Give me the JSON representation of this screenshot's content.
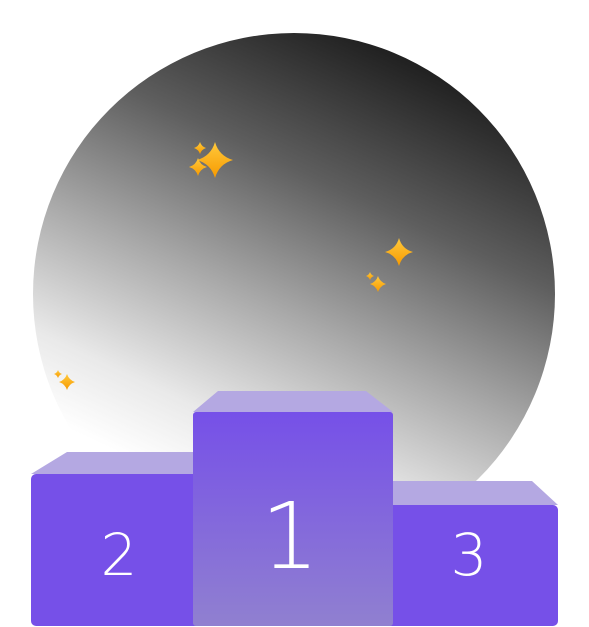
{
  "podium": {
    "first_place": "1",
    "second_place": "2",
    "third_place": "3"
  },
  "colors": {
    "backdrop_dark": "#1a1a1a",
    "backdrop_light": "#ffffff",
    "podium_front": "#7650e8",
    "podium_center_top": "#7650e8",
    "podium_center_bottom": "#9080d0",
    "podium_top": "#b4a8e2",
    "sparkle": "#ffb11a",
    "number": "#ffffff"
  },
  "icons": [
    "sparkles-icon",
    "sparkle-icon",
    "sparkle-small-icon",
    "sparkles-small-icon"
  ]
}
